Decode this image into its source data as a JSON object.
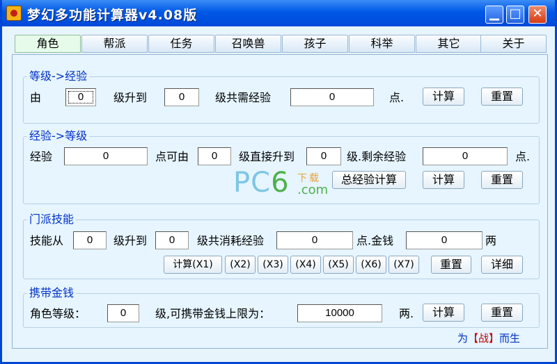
{
  "window": {
    "title": "梦幻多功能计算器v4.08版",
    "minimize_glyph": "▁",
    "maximize_glyph": "□",
    "close_glyph": "✕"
  },
  "tabs": [
    {
      "label": "角色",
      "active": true
    },
    {
      "label": "帮派"
    },
    {
      "label": "任务"
    },
    {
      "label": "召唤兽"
    },
    {
      "label": "孩子"
    },
    {
      "label": "科举"
    },
    {
      "label": "其它"
    },
    {
      "label": "关于"
    }
  ],
  "level_to_exp": {
    "title": "等级->经验",
    "from_label": "由",
    "from_value": "0",
    "upgrade_label": "级升到",
    "to_value": "0",
    "total_label": "级共需经验",
    "total_value": "0",
    "unit": "点.",
    "calc_button": "计算",
    "reset_button": "重置"
  },
  "exp_to_level": {
    "title": "经验->等级",
    "exp_label": "经验",
    "exp_value": "0",
    "from_label": "点可由",
    "from_value": "0",
    "direct_label": "级直接升到",
    "to_value": "0",
    "remaining_label": "级.剩余经验",
    "remaining_value": "0",
    "unit": "点.",
    "total_exp_button": "总经验计算",
    "calc_button": "计算",
    "reset_button": "重置"
  },
  "skills": {
    "title": "门派技能",
    "skill_from_label": "技能从",
    "from_value": "0",
    "upgrade_label": "级升到",
    "to_value": "0",
    "consume_label": "级共消耗经验",
    "exp_value": "0",
    "money_label": "点.金钱",
    "money_value": "0",
    "money_unit": "两",
    "calc_buttons": [
      "计算(X1)",
      "(X2)",
      "(X3)",
      "(X4)",
      "(X5)",
      "(X6)",
      "(X7)"
    ],
    "reset_button": "重置",
    "detail_button": "详细"
  },
  "carry_money": {
    "title": "携带金钱",
    "role_level_label": "角色等级：",
    "level_value": "0",
    "limit_label": "级,可携带金钱上限为：",
    "limit_value": "10000",
    "unit": "两.",
    "calc_button": "计算",
    "reset_button": "重置"
  },
  "footer": {
    "prefix": "为",
    "highlight": "【战】",
    "suffix": "而生"
  },
  "watermark": {
    "pc": "PC",
    "six": "6",
    "download": "下载",
    "com": ".com"
  }
}
